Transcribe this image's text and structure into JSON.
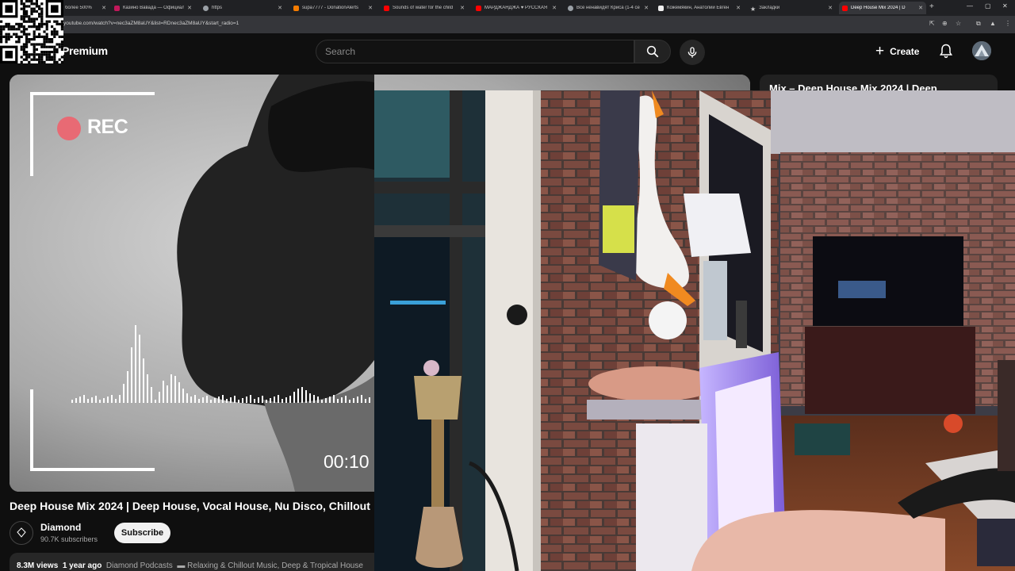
{
  "browser": {
    "tabs": [
      {
        "title": "более 500%",
        "favicon_color": "#9aa0a6"
      },
      {
        "title": "Казино Вавада — Официальн",
        "favicon_color": "#c2185b"
      },
      {
        "title": "https",
        "favicon_color": "#9aa0a6"
      },
      {
        "title": "supa7777 - DonationAlerts",
        "favicon_color": "#f57c00"
      },
      {
        "title": "Sounds of water for the child",
        "favicon_color": "#ff0000"
      },
      {
        "title": "МАРДЖАНДЖА ♥ РУССКАЯ",
        "favicon_color": "#ff0000"
      },
      {
        "title": "Все ненавидят Криса (1-4 се",
        "favicon_color": "#9aa0a6"
      },
      {
        "title": "Кожемякин, Анатолий Евген",
        "favicon_color": "#eeeeee"
      },
      {
        "title": "Закладки",
        "favicon_color": "#9aa0a6"
      },
      {
        "title": "Deep House Mix 2024 | D",
        "favicon_color": "#ff0000"
      }
    ],
    "new_tab": "+",
    "window_controls": [
      "—",
      "▢",
      "✕"
    ],
    "url": "youtube.com/watch?v=nec3aZM8aUY&list=RDnec3aZM8aUY&start_radio=1"
  },
  "header": {
    "brand": "Premium",
    "search_placeholder": "Search",
    "create_label": "Create"
  },
  "player": {
    "rec_label": "REC",
    "timer": "00:10"
  },
  "sidebar": {
    "first_title": "Mix – Deep House Mix 2024 | Deep"
  },
  "video": {
    "title": "Deep House Mix 2024 | Deep House, Vocal House, Nu Disco, Chillout",
    "channel": "Diamond",
    "subscribers": "90.7K subscribers",
    "subscribe_label": "Subscribe",
    "views": "8.3M views",
    "age": "1 year ago",
    "tag1": "Diamond Podcasts",
    "tag2": "Relaxing & Chillout Music, Deep & Tropical House"
  },
  "colors": {
    "accent": "#ff0000",
    "background": "#0f0f0f",
    "rec_dot": "#e86a74"
  },
  "icons": [
    "search-icon",
    "mic-icon",
    "plus-icon",
    "bell-icon",
    "close-icon",
    "star-icon",
    "zoom-icon"
  ]
}
